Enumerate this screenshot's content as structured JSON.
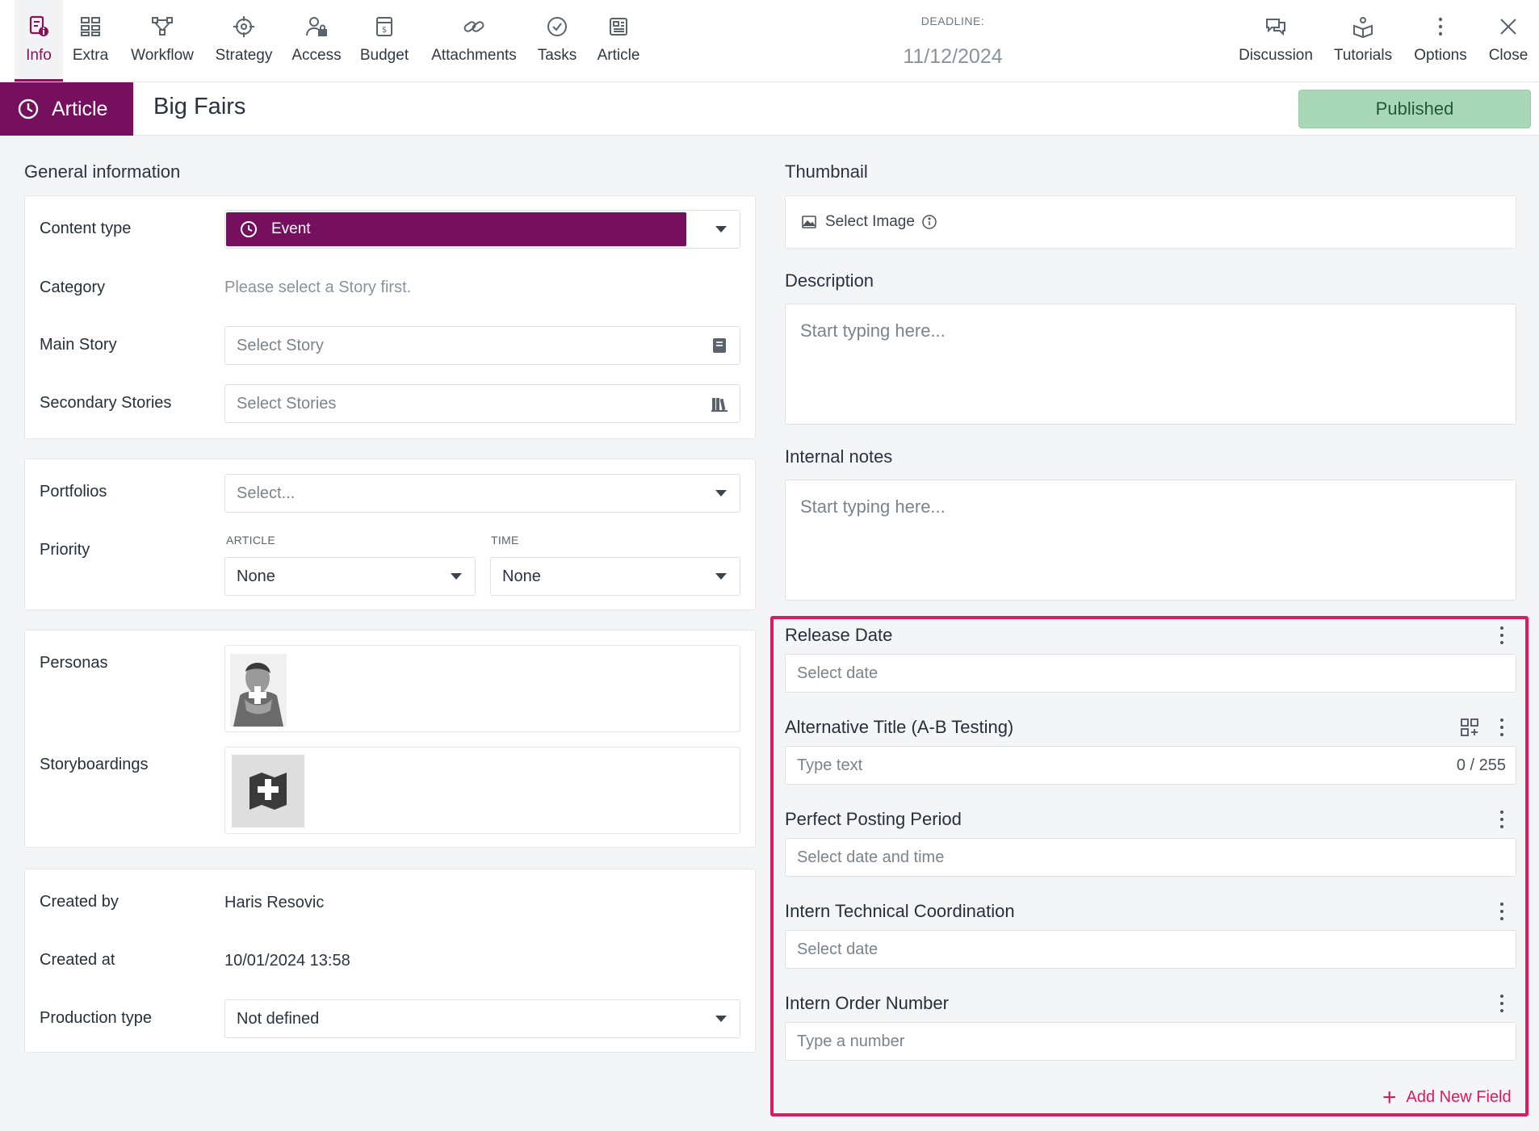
{
  "nav": {
    "tabs": [
      {
        "label": "Info"
      },
      {
        "label": "Extra"
      },
      {
        "label": "Workflow"
      },
      {
        "label": "Strategy"
      },
      {
        "label": "Access"
      },
      {
        "label": "Budget"
      },
      {
        "label": "Attachments"
      },
      {
        "label": "Tasks"
      },
      {
        "label": "Article"
      }
    ],
    "right_tabs": [
      {
        "label": "Discussion"
      },
      {
        "label": "Tutorials"
      },
      {
        "label": "Options"
      },
      {
        "label": "Close"
      }
    ],
    "deadline_label": "DEADLINE:",
    "deadline_value": "11/12/2024"
  },
  "header": {
    "badge": "Article",
    "title": "Big Fairs",
    "status": "Published"
  },
  "general": {
    "title": "General information",
    "content_type_label": "Content type",
    "content_type_value": "Event",
    "category_label": "Category",
    "category_hint": "Please select a Story first.",
    "main_story_label": "Main Story",
    "main_story_placeholder": "Select Story",
    "secondary_label": "Secondary Stories",
    "secondary_placeholder": "Select Stories"
  },
  "portfolio": {
    "portfolios_label": "Portfolios",
    "portfolios_placeholder": "Select...",
    "priority_label": "Priority",
    "article_sublabel": "ARTICLE",
    "time_sublabel": "TIME",
    "article_value": "None",
    "time_value": "None"
  },
  "personas": {
    "personas_label": "Personas",
    "storyboardings_label": "Storyboardings"
  },
  "meta": {
    "created_by_label": "Created by",
    "created_by_value": "Haris Resovic",
    "created_at_label": "Created at",
    "created_at_value": "10/01/2024 13:58",
    "production_label": "Production type",
    "production_value": "Not defined"
  },
  "right": {
    "thumbnail_title": "Thumbnail",
    "select_image": "Select Image",
    "description_title": "Description",
    "description_placeholder": "Start typing here...",
    "notes_title": "Internal notes",
    "notes_placeholder": "Start typing here..."
  },
  "custom_fields": {
    "fields": [
      {
        "title": "Release Date",
        "placeholder": "Select date"
      },
      {
        "title": "Alternative Title (A-B Testing)",
        "placeholder": "Type text",
        "counter": "0 / 255"
      },
      {
        "title": "Perfect Posting Period",
        "placeholder": "Select date and time"
      },
      {
        "title": "Intern Technical Coordination",
        "placeholder": "Select date"
      },
      {
        "title": "Intern Order Number",
        "placeholder": "Type a number"
      }
    ],
    "add_label": "Add New Field"
  },
  "colors": {
    "accent": "#750f5e",
    "active_tab": "#8a1254",
    "published": "#a8d8b7",
    "highlight": "#d81b62"
  }
}
